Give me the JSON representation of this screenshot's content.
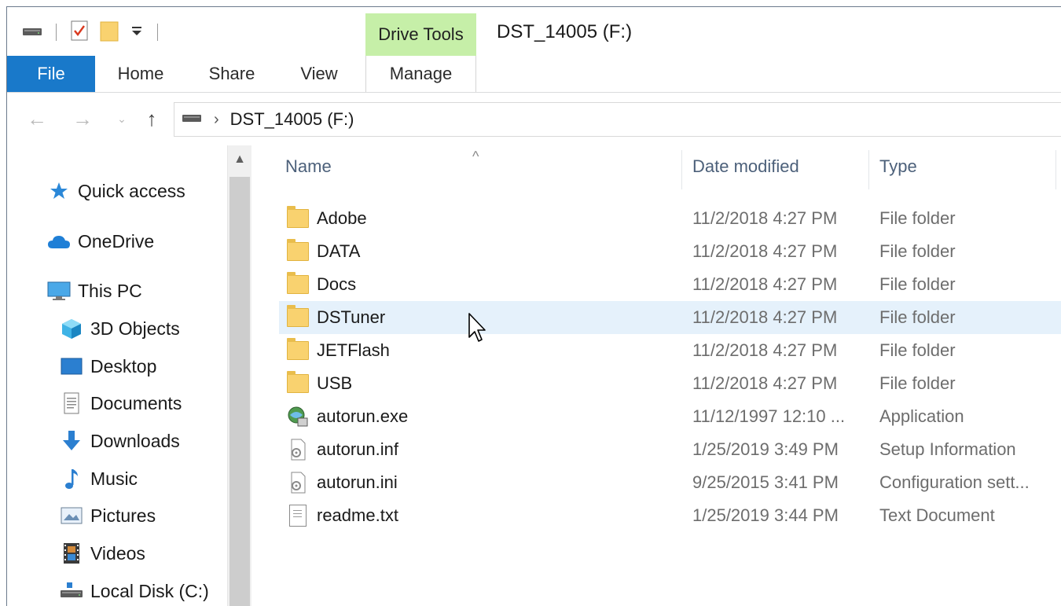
{
  "window": {
    "title": "DST_14005 (F:)",
    "contextual_tab": "Drive Tools"
  },
  "quick_access_toolbar": {
    "icons": [
      "drive-icon",
      "properties-icon",
      "new-folder-icon",
      "customize-dropdown-icon"
    ]
  },
  "ribbon": {
    "tabs": [
      {
        "label": "File"
      },
      {
        "label": "Home"
      },
      {
        "label": "Share"
      },
      {
        "label": "View"
      },
      {
        "label": "Manage"
      }
    ]
  },
  "address_bar": {
    "crumbs": [
      "DST_14005 (F:)"
    ]
  },
  "nav_pane": {
    "items": [
      {
        "label": "Quick access",
        "icon": "star-icon"
      },
      {
        "label": "OneDrive",
        "icon": "cloud-icon"
      },
      {
        "label": "This PC",
        "icon": "monitor-icon"
      },
      {
        "label": "3D Objects",
        "icon": "cube-icon"
      },
      {
        "label": "Desktop",
        "icon": "desktop-icon"
      },
      {
        "label": "Documents",
        "icon": "documents-icon"
      },
      {
        "label": "Downloads",
        "icon": "download-arrow-icon"
      },
      {
        "label": "Music",
        "icon": "music-note-icon"
      },
      {
        "label": "Pictures",
        "icon": "pictures-icon"
      },
      {
        "label": "Videos",
        "icon": "film-icon"
      },
      {
        "label": "Local Disk (C:)",
        "icon": "local-disk-icon"
      }
    ]
  },
  "file_list": {
    "columns": {
      "name": "Name",
      "date": "Date modified",
      "type": "Type"
    },
    "rows": [
      {
        "name": "Adobe",
        "date": "11/2/2018 4:27 PM",
        "type": "File folder",
        "icon": "folder-icon"
      },
      {
        "name": "DATA",
        "date": "11/2/2018 4:27 PM",
        "type": "File folder",
        "icon": "folder-icon"
      },
      {
        "name": "Docs",
        "date": "11/2/2018 4:27 PM",
        "type": "File folder",
        "icon": "folder-icon"
      },
      {
        "name": "DSTuner",
        "date": "11/2/2018 4:27 PM",
        "type": "File folder",
        "icon": "folder-icon"
      },
      {
        "name": "JETFlash",
        "date": "11/2/2018 4:27 PM",
        "type": "File folder",
        "icon": "folder-icon"
      },
      {
        "name": "USB",
        "date": "11/2/2018 4:27 PM",
        "type": "File folder",
        "icon": "folder-icon"
      },
      {
        "name": "autorun.exe",
        "date": "11/12/1997 12:10 ...",
        "type": "Application",
        "icon": "setup-exe-icon"
      },
      {
        "name": "autorun.inf",
        "date": "1/25/2019 3:49 PM",
        "type": "Setup Information",
        "icon": "settings-file-icon"
      },
      {
        "name": "autorun.ini",
        "date": "9/25/2015 3:41 PM",
        "type": "Configuration sett...",
        "icon": "settings-file-icon"
      },
      {
        "name": "readme.txt",
        "date": "1/25/2019 3:44 PM",
        "type": "Text Document",
        "icon": "text-file-icon"
      }
    ],
    "hovered_row": "DSTuner"
  },
  "colors": {
    "file_tab": "#1979ca",
    "drive_tools_tab": "#c6efa8",
    "hover_row": "#e5f1fb",
    "folder": "#f9d26f"
  }
}
